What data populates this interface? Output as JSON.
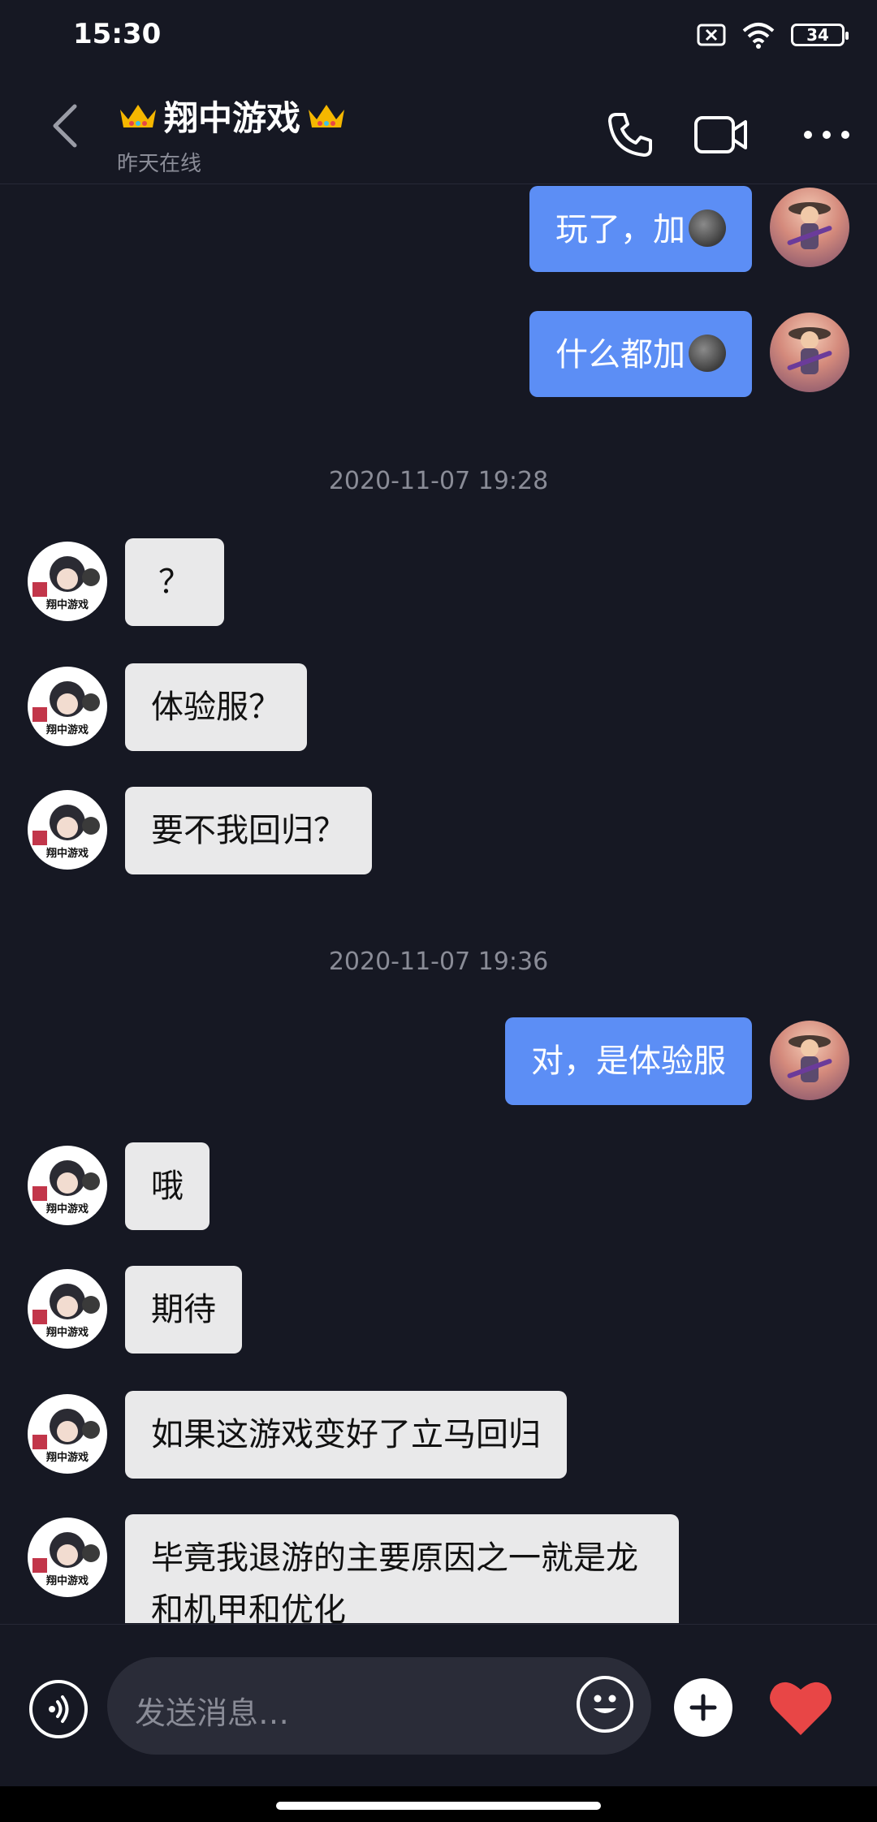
{
  "status": {
    "time": "15:30",
    "battery": "34"
  },
  "header": {
    "title": "翔中游戏",
    "subtitle": "昨天在线"
  },
  "messages": [
    {
      "side": "self",
      "text": "玩了，加",
      "emoji": "moon"
    },
    {
      "side": "self",
      "text": "什么都加",
      "emoji": "moon"
    },
    {
      "timestamp": "2020-11-07 19:28"
    },
    {
      "side": "other",
      "text": "？"
    },
    {
      "side": "other",
      "text": "体验服？"
    },
    {
      "side": "other",
      "text": "要不我回归？"
    },
    {
      "timestamp": "2020-11-07 19:36"
    },
    {
      "side": "self",
      "text": "对，是体验服"
    },
    {
      "side": "other",
      "text": "哦"
    },
    {
      "side": "other",
      "text": "期待"
    },
    {
      "side": "other",
      "text": "如果这游戏变好了立马回归"
    },
    {
      "side": "other",
      "text": "毕竟我退游的主要原因之一就是龙和机甲和优化"
    }
  ],
  "composer": {
    "placeholder": "发送消息…"
  },
  "colors": {
    "background": "#161823",
    "self_bubble": "#5c8ef5",
    "other_bubble": "#e9e9ea",
    "accent_heart": "#e84646"
  }
}
